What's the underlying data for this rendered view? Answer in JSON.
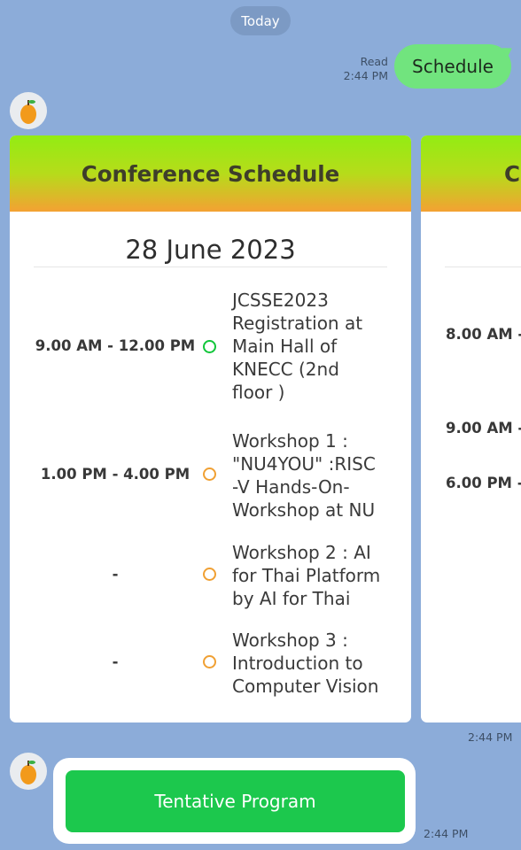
{
  "chat": {
    "date_divider": "Today",
    "user_message": {
      "text": "Schedule",
      "read_label": "Read",
      "time": "2:44 PM"
    },
    "carousel_time": "2:44 PM",
    "button_time": "2:44 PM"
  },
  "card": {
    "title": "Conference Schedule",
    "date": "28 June 2023",
    "events": [
      {
        "time": "9.00 AM - 12.00 PM",
        "status": "green",
        "lines": [
          "JCSSE2023",
          "Registration at",
          "Main Hall of",
          "KNECC (2nd",
          "floor )"
        ]
      },
      {
        "time": "1.00 PM - 4.00 PM",
        "status": "orange",
        "lines": [
          "Workshop 1 :",
          "\"NU4YOU\" :RISC",
          "-V Hands-On-",
          "Workshop at NU"
        ]
      },
      {
        "time": "-",
        "status": "orange",
        "lines": [
          "Workshop 2 : AI",
          "for Thai Platform",
          "by AI for Thai"
        ]
      },
      {
        "time": "-",
        "status": "orange",
        "lines": [
          "Workshop 3 :",
          "Introduction to",
          "Computer Vision"
        ]
      }
    ]
  },
  "next_card": {
    "title_fragment": "C",
    "times": [
      "8.00 AM -",
      "9.00 AM -",
      "6.00 PM -"
    ]
  },
  "action": {
    "button_label": "Tentative Program"
  },
  "colors": {
    "background": "#8cacd9",
    "user_bubble": "#71e47e",
    "button": "#1cc84d",
    "status_green": "#11c63a",
    "status_orange": "#f0a033"
  }
}
